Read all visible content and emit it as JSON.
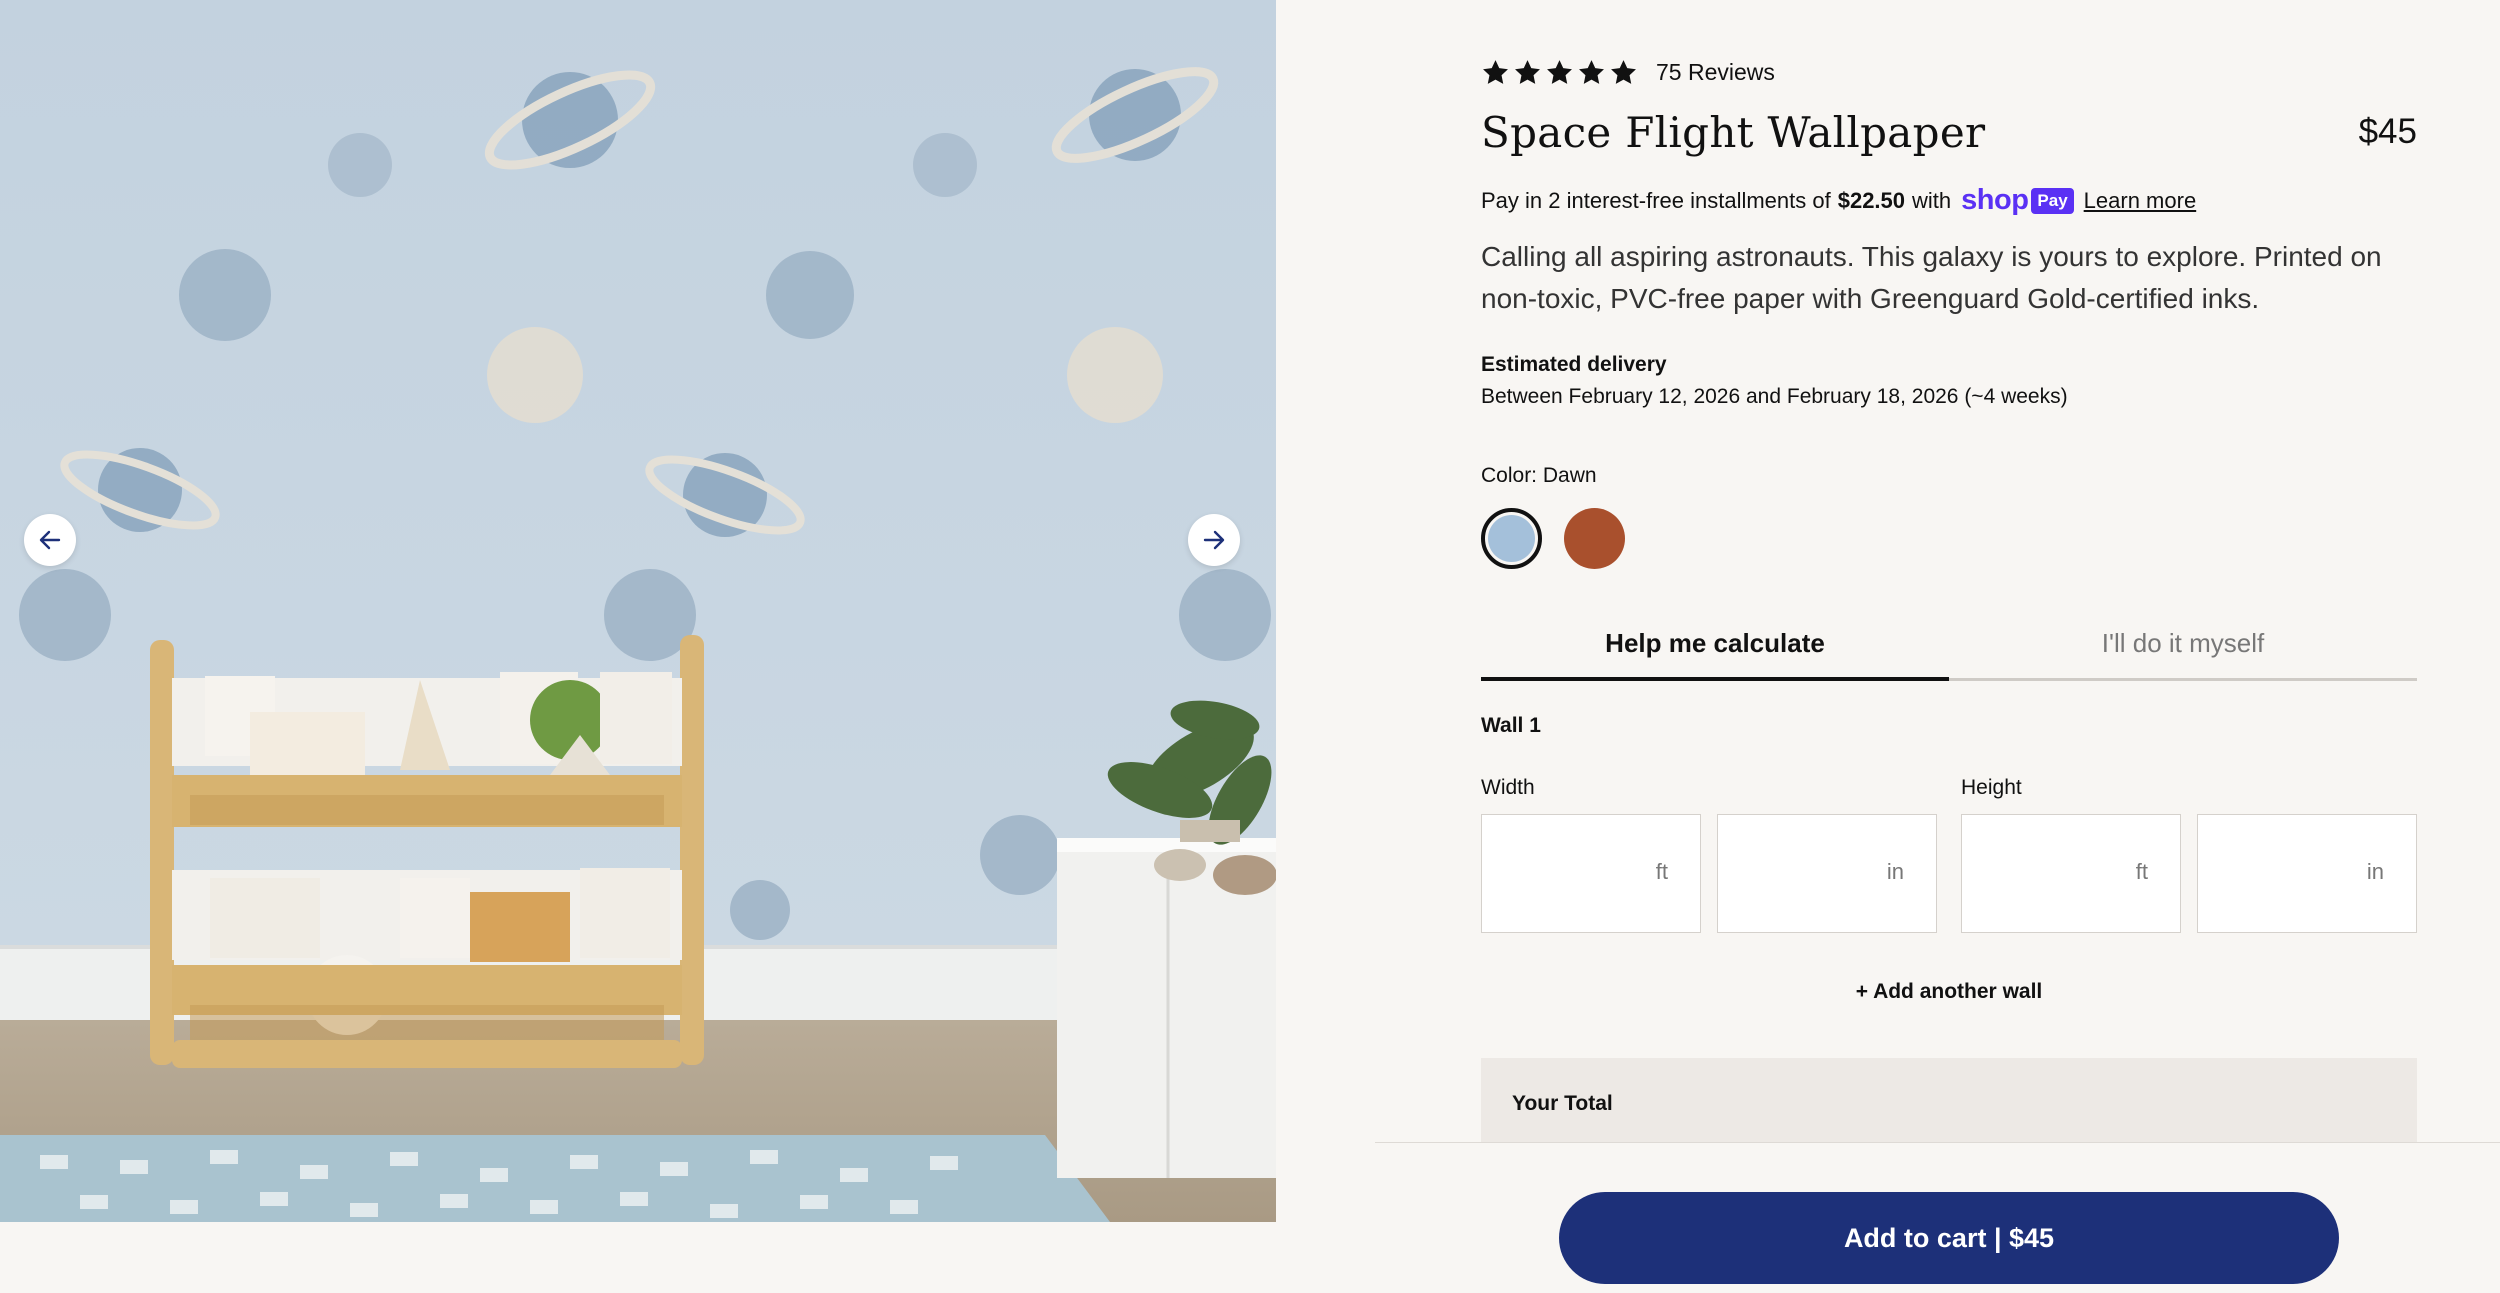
{
  "product": {
    "rating_value": 5,
    "reviews_label": "75 Reviews",
    "title": "Space Flight Wallpaper",
    "price": "$45",
    "description": "Calling all aspiring astronauts. This galaxy is yours to explore. Printed on non-toxic, PVC-free paper with Greenguard Gold-certified inks."
  },
  "installments": {
    "prefix": "Pay in 2 interest-free installments of",
    "amount": "$22.50",
    "with": "with",
    "shop_word": "shop",
    "pay_badge": "Pay",
    "learn_more": "Learn more"
  },
  "delivery": {
    "label": "Estimated delivery",
    "value": "Between February 12, 2026 and February 18, 2026 (~4 weeks)"
  },
  "color": {
    "label": "Color: Dawn",
    "options": [
      {
        "name": "Dawn",
        "hex": "#a4c0da",
        "selected": true
      },
      {
        "name": "rust",
        "hex": "#a9502d",
        "selected": false
      }
    ]
  },
  "tabs": [
    {
      "label": "Help me calculate",
      "active": true
    },
    {
      "label": "I'll do it myself",
      "active": false
    }
  ],
  "calculator": {
    "wall_label": "Wall 1",
    "width_label": "Width",
    "height_label": "Height",
    "fields": [
      {
        "unit": "ft",
        "value": ""
      },
      {
        "unit": "in",
        "value": ""
      },
      {
        "unit": "ft",
        "value": ""
      },
      {
        "unit": "in",
        "value": ""
      }
    ],
    "add_wall": "+ Add another wall",
    "total_label": "Your Total"
  },
  "cart": {
    "button_label": "Add to cart | $45"
  },
  "icons": {
    "prev": "arrow-left-icon",
    "next": "arrow-right-icon",
    "star": "star-icon"
  },
  "colors": {
    "accent": "#1d3079",
    "shop_purple": "#5a31f4",
    "page_bg": "#f8f6f3"
  }
}
